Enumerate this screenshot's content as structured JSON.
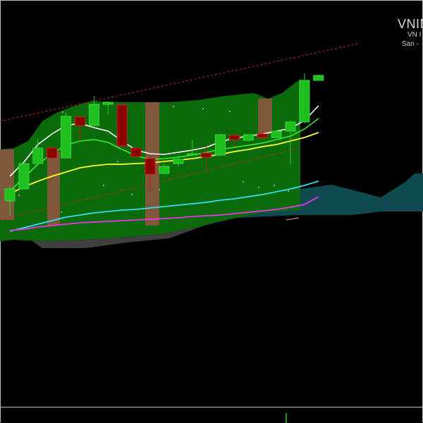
{
  "header": {
    "symbol": "VNIN",
    "exchange": "VN I",
    "venue": "San -"
  },
  "colors": {
    "background": "#000000",
    "bull_candle": "#1fbf1f",
    "bear_candle": "#8b0000",
    "band_fill": "#0b6b0b",
    "lower_fill": "#3f3f3f",
    "cloud": "#0f4a4e",
    "ma_fast": "#ffffff",
    "ma_mid": "#33ee33",
    "ma_slow": "#ffff33",
    "ma_long": "#33e0ee",
    "ma_longest": "#ee33ee",
    "channel": "#cc2222",
    "highlight": "#b05050"
  },
  "chart_data": {
    "type": "candlestick",
    "title": "",
    "xlabel": "",
    "ylabel": "",
    "ylim": [
      0,
      600
    ],
    "grid": false,
    "candles": [
      {
        "o": 285,
        "h": 305,
        "l": 263,
        "c": 268
      },
      {
        "o": 268,
        "h": 262,
        "l": 230,
        "c": 232
      },
      {
        "o": 232,
        "h": 208,
        "l": 196,
        "c": 210
      },
      {
        "o": 210,
        "h": 207,
        "l": 226,
        "c": 224
      },
      {
        "o": 224,
        "h": 190,
        "l": 160,
        "c": 165
      },
      {
        "o": 166,
        "h": 164,
        "l": 200,
        "c": 178
      },
      {
        "o": 178,
        "h": 160,
        "l": 136,
        "c": 148
      },
      {
        "o": 148,
        "h": 144,
        "l": 162,
        "c": 145
      },
      {
        "o": 149,
        "h": 146,
        "l": 212,
        "c": 207
      },
      {
        "o": 210,
        "h": 208,
        "l": 223,
        "c": 222
      },
      {
        "o": 225,
        "h": 221,
        "l": 272,
        "c": 247
      },
      {
        "o": 246,
        "h": 232,
        "l": 248,
        "c": 236
      },
      {
        "o": 232,
        "h": 220,
        "l": 236,
        "c": 226
      },
      {
        "o": 220,
        "h": 198,
        "l": 222,
        "c": 218
      },
      {
        "o": 217,
        "h": 207,
        "l": 243,
        "c": 223
      },
      {
        "o": 220,
        "h": 190,
        "l": 222,
        "c": 191
      },
      {
        "o": 192,
        "h": 190,
        "l": 208,
        "c": 198
      },
      {
        "o": 199,
        "h": 191,
        "l": 200,
        "c": 191
      },
      {
        "o": 190,
        "h": 187,
        "l": 198,
        "c": 195
      },
      {
        "o": 195,
        "h": 185,
        "l": 196,
        "c": 186
      },
      {
        "o": 186,
        "h": 171,
        "l": 234,
        "c": 173
      },
      {
        "o": 173,
        "h": 104,
        "l": 175,
        "c": 114
      },
      {
        "o": 114,
        "h": 106,
        "l": 108,
        "c": 107
      }
    ],
    "series": [
      {
        "key": "ma_fast",
        "values": [
          250,
          230,
          205,
          190,
          178,
          175,
          181,
          186,
          200,
          213,
          218,
          219,
          216,
          213,
          209,
          201,
          196,
          193,
          190,
          186,
          182,
          171,
          150
        ]
      },
      {
        "key": "ma_mid",
        "values": [
          271,
          252,
          233,
          218,
          206,
          200,
          198,
          202,
          212,
          221,
          226,
          225,
          223,
          220,
          216,
          212,
          209,
          206,
          203,
          198,
          193,
          183,
          168
        ]
      },
      {
        "key": "ma_slow",
        "values": [
          275,
          265,
          257,
          250,
          244,
          238,
          235,
          233,
          233,
          232,
          231,
          229,
          227,
          225,
          222,
          219,
          215,
          212,
          208,
          205,
          200,
          195,
          188
        ]
      },
      {
        "key": "ma_long",
        "values": [
          328,
          323,
          318,
          313,
          308,
          305,
          302,
          300,
          298,
          297,
          295,
          293,
          291,
          289,
          287,
          284,
          282,
          279,
          276,
          272,
          268,
          263,
          257
        ]
      },
      {
        "key": "ma_longest",
        "values": [
          327,
          325,
          322,
          320,
          318,
          316,
          315,
          314,
          313,
          312,
          311,
          310,
          309,
          307,
          306,
          305,
          303,
          301,
          299,
          297,
          294,
          290,
          279
        ]
      }
    ]
  }
}
